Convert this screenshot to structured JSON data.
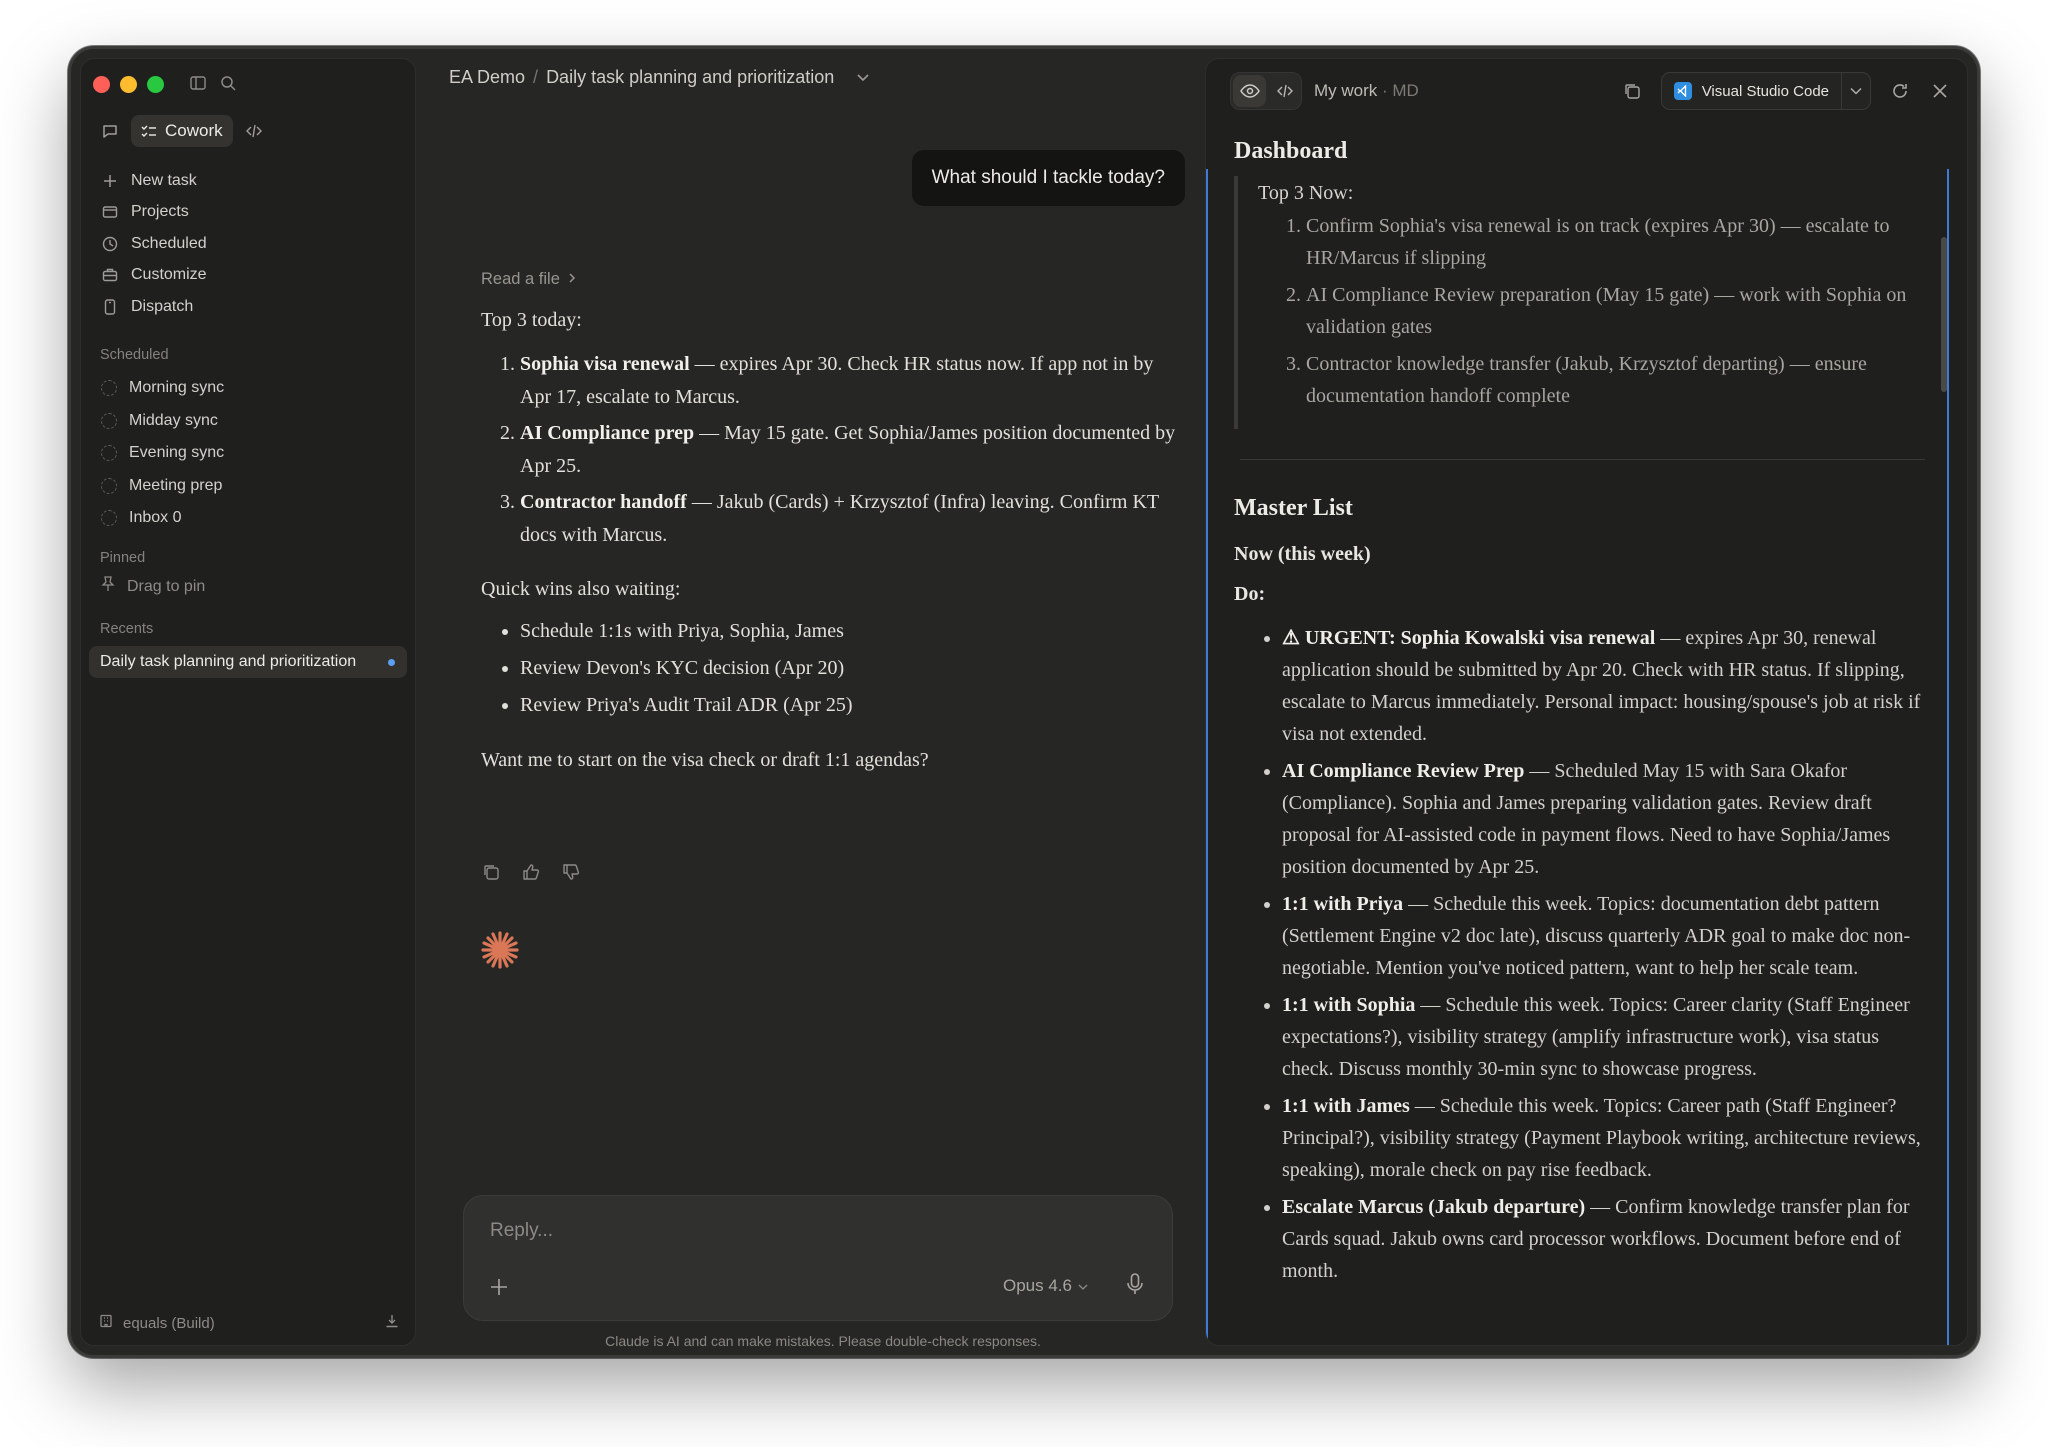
{
  "sidebar": {
    "mode_label": "Cowork",
    "nav": [
      {
        "label": "New task",
        "icon": "plus-icon"
      },
      {
        "label": "Projects",
        "icon": "folder-icon"
      },
      {
        "label": "Scheduled",
        "icon": "clock-icon"
      },
      {
        "label": "Customize",
        "icon": "briefcase-icon"
      },
      {
        "label": "Dispatch",
        "icon": "phone-icon"
      }
    ],
    "scheduled_label": "Scheduled",
    "scheduled": [
      "Morning sync",
      "Midday sync",
      "Evening sync",
      "Meeting prep",
      "Inbox 0"
    ],
    "pinned_label": "Pinned",
    "pin_hint": "Drag to pin",
    "recents_label": "Recents",
    "recent": "Daily task planning and prioritization",
    "footer": "equals (Build)"
  },
  "header": {
    "project": "EA Demo",
    "separator": "/",
    "task": "Daily task planning and prioritization"
  },
  "chat": {
    "user_message": "What should I tackle today?",
    "tool_label": "Read a file",
    "intro": "Top 3 today:",
    "top3": [
      {
        "bold": "Sophia visa renewal",
        "text": " — expires Apr 30. Check HR status now. If app not in by Apr 17, escalate to Marcus."
      },
      {
        "bold": "AI Compliance prep",
        "text": " — May 15 gate. Get Sophia/James position documented by Apr 25."
      },
      {
        "bold": "Contractor handoff",
        "text": " — Jakub (Cards) + Krzysztof (Infra) leaving. Confirm KT docs with Marcus."
      }
    ],
    "quick_wins_label": "Quick wins also waiting:",
    "quick_wins": [
      "Schedule 1:1s with Priya, Sophia, James",
      "Review Devon's KYC decision (Apr 20)",
      "Review Priya's Audit Trail ADR (Apr 25)"
    ],
    "closing": "Want me to start on the visa check or draft 1:1 agendas?"
  },
  "composer": {
    "placeholder": "Reply...",
    "model": "Opus 4.6",
    "disclaimer": "Claude is AI and can make mistakes. Please double-check responses."
  },
  "panel": {
    "title": "My work",
    "title_suffix": "· MD",
    "open_in": "Visual Studio Code",
    "dashboard_heading": "Dashboard",
    "top3_heading": "Top 3 Now:",
    "top3": [
      "Confirm Sophia's visa renewal is on track (expires Apr 30) — escalate to HR/Marcus if slipping",
      "AI Compliance Review preparation (May 15 gate) — work with Sophia on validation gates",
      "Contractor knowledge transfer (Jakub, Krzysztof departing) — ensure documentation handoff complete"
    ],
    "master_heading": "Master List",
    "now_heading": "Now (this week)",
    "do_label": "Do:",
    "items": [
      {
        "bold": "⚠ URGENT: Sophia Kowalski visa renewal",
        "text": " — expires Apr 30, renewal application should be submitted by Apr 20. Check with HR status. If slipping, escalate to Marcus immediately. Personal impact: housing/spouse's job at risk if visa not extended."
      },
      {
        "bold": "AI Compliance Review Prep",
        "text": " — Scheduled May 15 with Sara Okafor (Compliance). Sophia and James preparing validation gates. Review draft proposal for AI-assisted code in payment flows. Need to have Sophia/James position documented by Apr 25."
      },
      {
        "bold": "1:1 with Priya",
        "text": " — Schedule this week. Topics: documentation debt pattern (Settlement Engine v2 doc late), discuss quarterly ADR goal to make doc non-negotiable. Mention you've noticed pattern, want to help her scale team."
      },
      {
        "bold": "1:1 with Sophia",
        "text": " — Schedule this week. Topics: Career clarity (Staff Engineer expectations?), visibility strategy (amplify infrastructure work), visa status check. Discuss monthly 30-min sync to showcase progress."
      },
      {
        "bold": "1:1 with James",
        "text": " — Schedule this week. Topics: Career path (Staff Engineer? Principal?), visibility strategy (Payment Playbook writing, architecture reviews, speaking), morale check on pay rise feedback."
      },
      {
        "bold": "Escalate Marcus (Jakub departure)",
        "text": " — Confirm knowledge transfer plan for Cards squad. Jakub owns card processor workflows. Document before end of month."
      }
    ]
  }
}
